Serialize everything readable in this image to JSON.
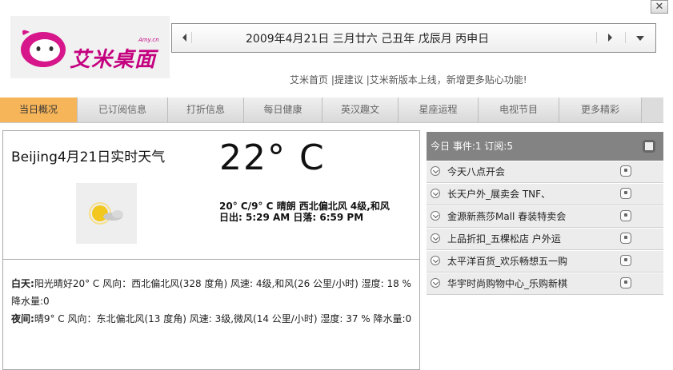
{
  "window": {
    "close_label": "✕"
  },
  "logo": {
    "text": "艾米桌面",
    "url_text": "Amy.cn"
  },
  "date_bar": {
    "date": "2009年4月21日 三月廿六 己丑年 戊辰月 丙申日"
  },
  "links": [
    "艾米首页",
    "|提建议",
    "|艾米新版本上线，新增更多贴心功能!"
  ],
  "tabs": [
    {
      "label": "当日概况",
      "active": true
    },
    {
      "label": "已订阅信息"
    },
    {
      "label": "打折信息"
    },
    {
      "label": "每日健康"
    },
    {
      "label": "英汉趣文"
    },
    {
      "label": "星座运程"
    },
    {
      "label": "电视节目"
    },
    {
      "label": "更多精彩"
    }
  ],
  "weather": {
    "title": "Beijing4月21日实时天气",
    "temp": "22° C",
    "summary": "20° C/9° C 晴朗 西北偏北风 4级,和风",
    "sun": "日出: 5:29 AM 日落: 6:59 PM",
    "day_label": "白天:",
    "day_text": "阳光晴好20° C 风向：西北偏北风(328 度角) 风速: 4级,和风(26 公里/小时) 湿度: 18 % 降水量:0",
    "night_label": "夜间:",
    "night_text": "晴9° C 风向：东北偏北风(13 度角) 风速: 3级,微风(14 公里/小时) 湿度: 37 % 降水量:0"
  },
  "events_panel": {
    "header": "今日 事件:1 订阅:5",
    "items": [
      "今天八点开会",
      "长天户外_展卖会 TNF、",
      "金源新燕莎Mall 春装特卖会",
      "上品折扣_五棵松店 户外运",
      "太平洋百货_欢乐畅想五一购",
      "华宇时尚购物中心_乐购新棋"
    ]
  }
}
